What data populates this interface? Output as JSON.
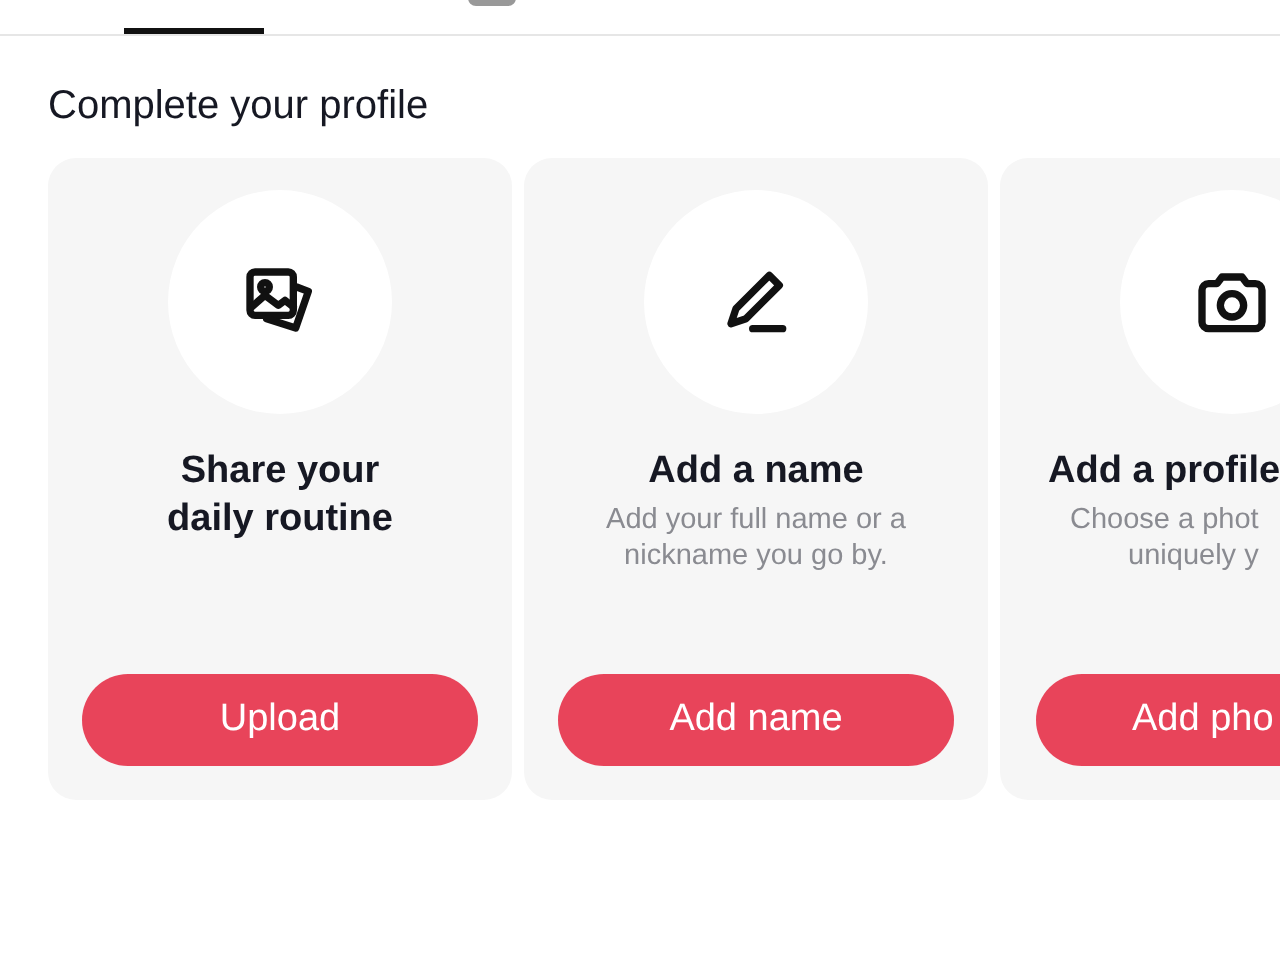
{
  "section_title": "Complete your profile",
  "cards": [
    {
      "kind": "photos",
      "title": "Share your\ndaily routine",
      "button": "Upload",
      "clipped": false
    },
    {
      "kind": "pencil",
      "title": "Add a name",
      "description": "Add your full name or a nickname you go by.",
      "button": "Add name",
      "clipped": false
    },
    {
      "kind": "camera",
      "title": "Add a profile",
      "description": "Choose a phot\nuniquely y",
      "button": "Add pho",
      "clipped": true
    }
  ]
}
